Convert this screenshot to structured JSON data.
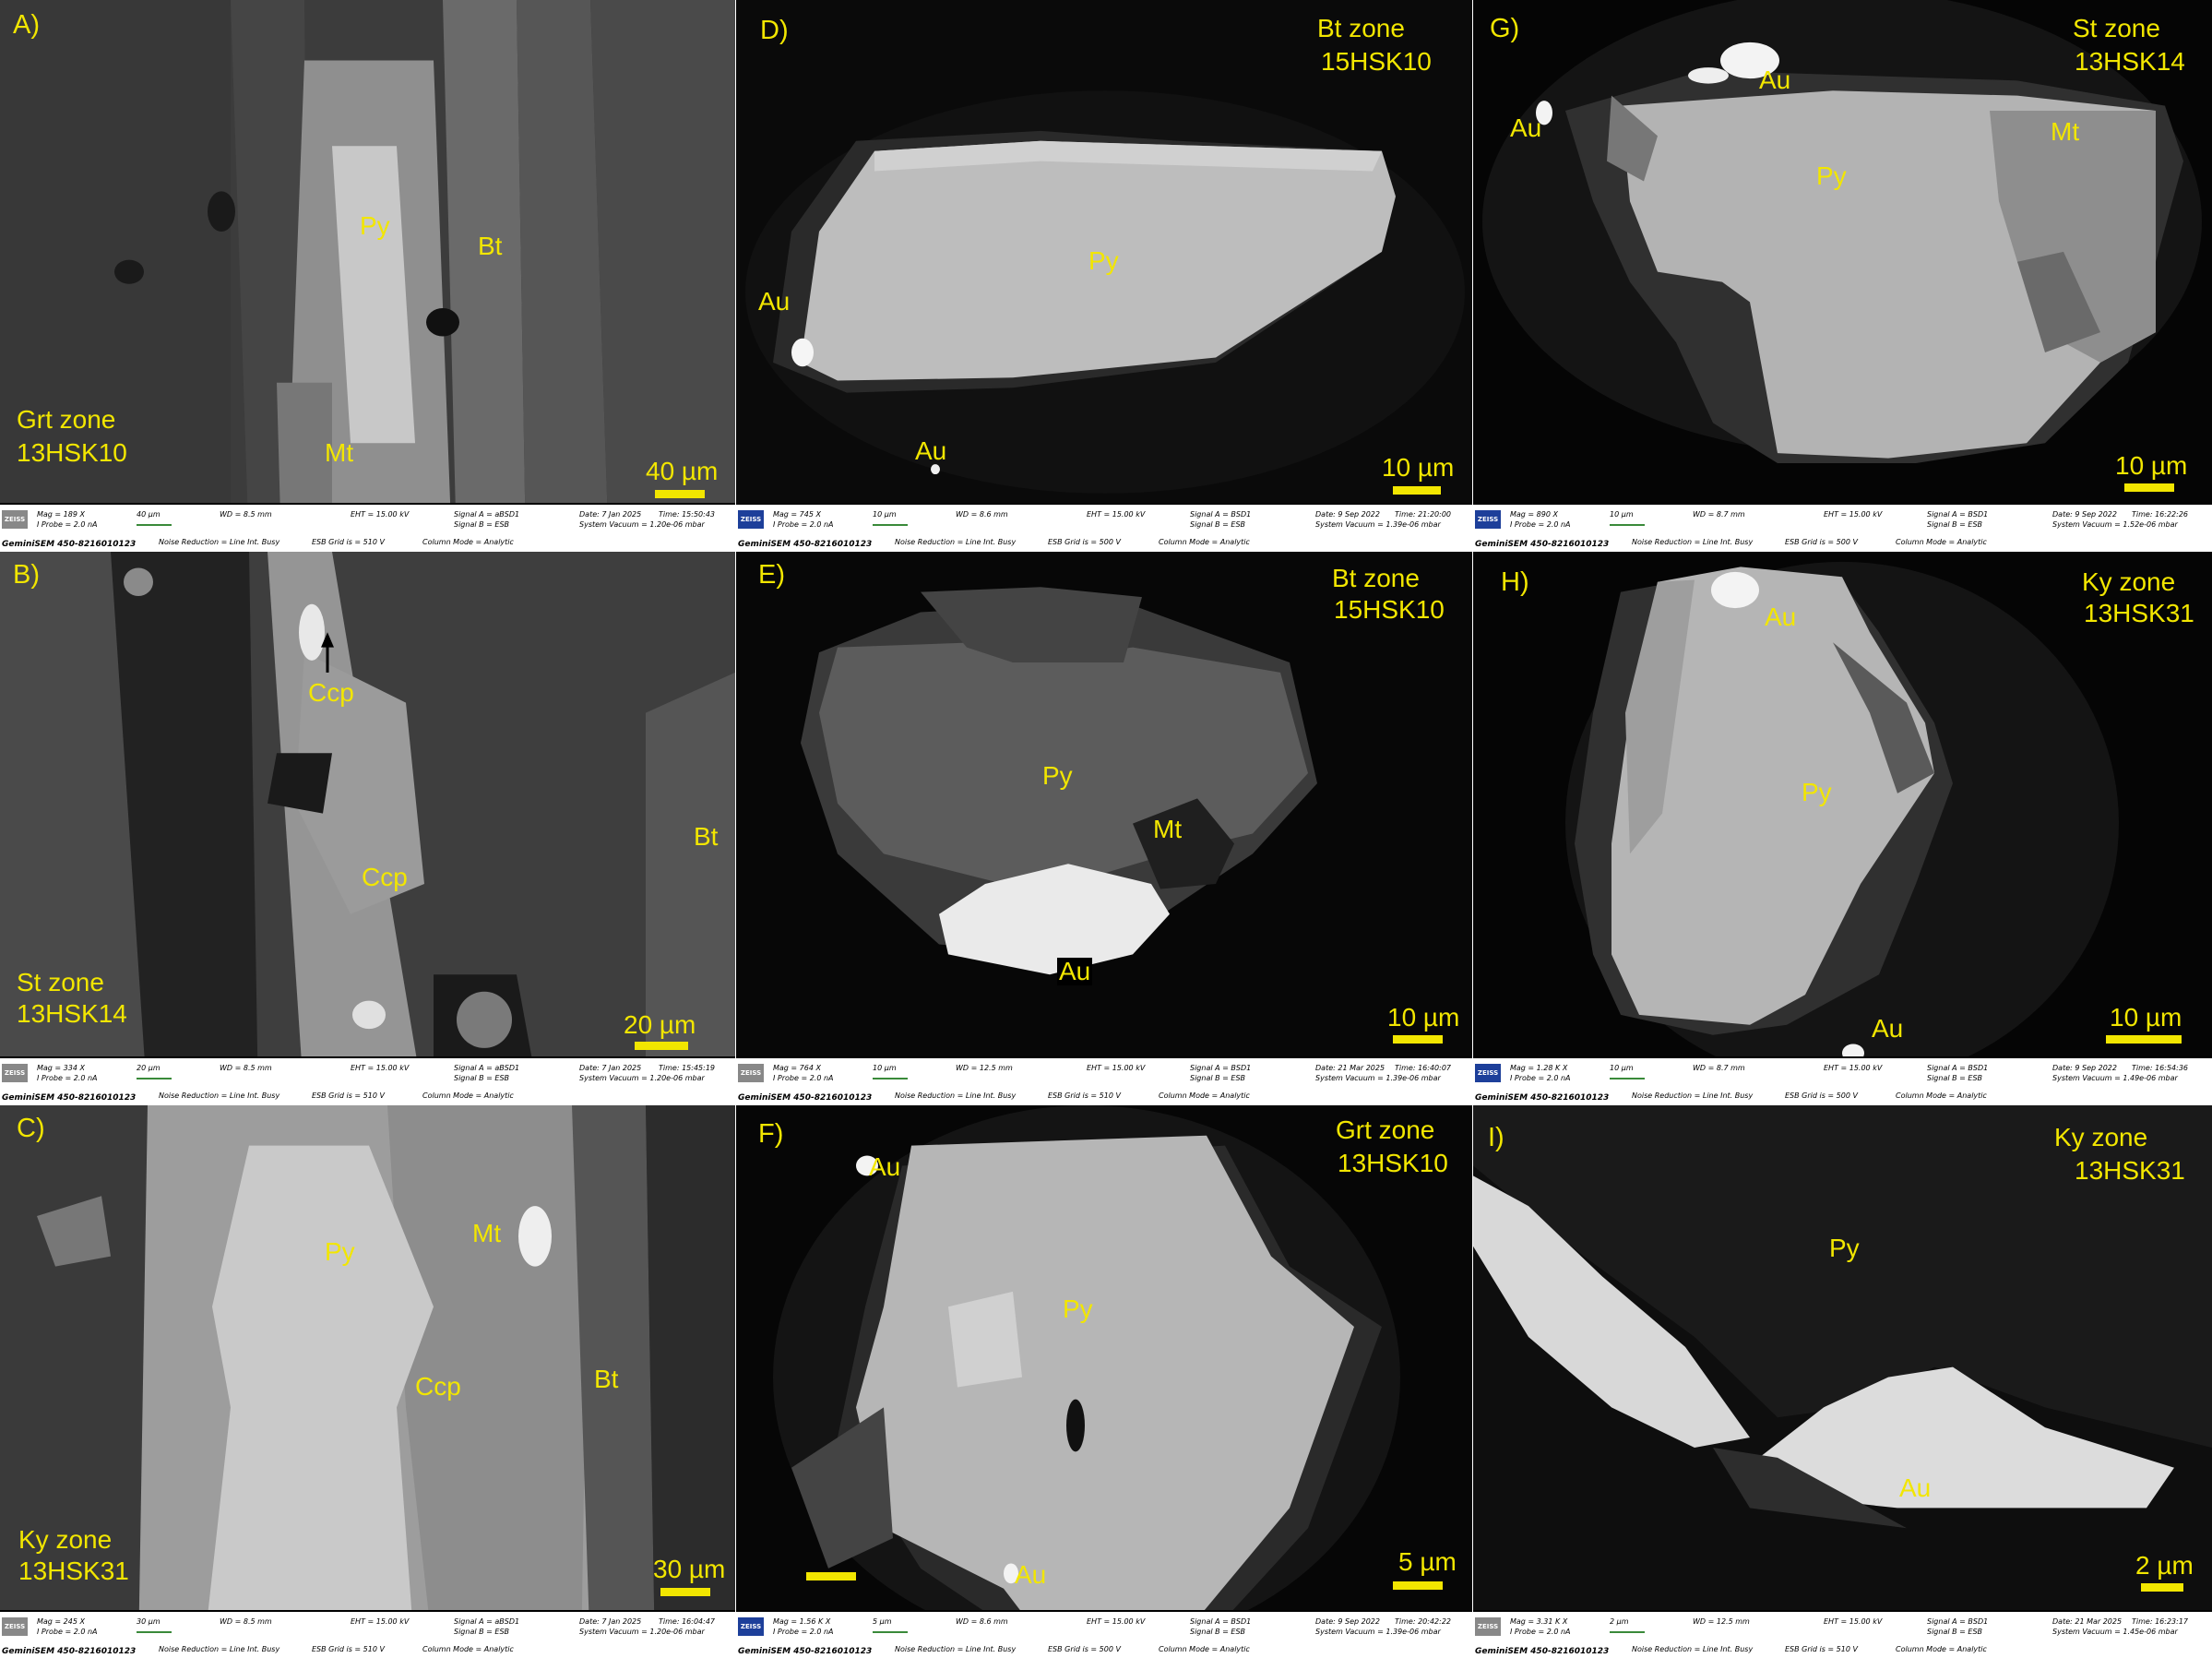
{
  "panels": [
    {
      "id": "A",
      "letter": "A)",
      "zone": "Grt zone",
      "sample": "13HSK10",
      "scale": "40 µm",
      "minerals": [
        "Py",
        "Bt",
        "Mt"
      ],
      "meta": {
        "mag": "Mag =  189 X",
        "scaleMini": "40 µm",
        "wd": "WD =  8.5 mm",
        "eht": "EHT = 15.00 kV",
        "sigA": "Signal A = aBSD1",
        "sigB": "Signal B = ESB",
        "date": "Date: 7 Jan 2025",
        "time": "Time: 15:50:43",
        "iprobe": "I Probe =   2.0 nA",
        "noise": "Noise Reduction = Line Int. Busy",
        "esb": "ESB Grid is =   510 V",
        "col": "Column Mode = Analytic",
        "vac": "System Vacuum = 1.20e-06 mbar",
        "inst": "GeminiSEM 450-8216010123"
      }
    },
    {
      "id": "D",
      "letter": "D)",
      "zone": "Bt zone",
      "sample": "15HSK10",
      "scale": "10 µm",
      "minerals": [
        "Py",
        "Au",
        "Au"
      ],
      "meta": {
        "mag": "Mag =   745 X",
        "scaleMini": "10 µm",
        "wd": "WD =  8.6 mm",
        "eht": "EHT = 15.00 kV",
        "sigA": "Signal A = BSD1",
        "sigB": "Signal B = ESB",
        "date": "Date: 9 Sep 2022",
        "time": "Time: 21:20:00",
        "iprobe": "I Probe =   2.0 nA",
        "noise": "Noise Reduction = Line Int. Busy",
        "esb": "ESB Grid is =   500 V",
        "col": "Column Mode = Analytic",
        "vac": "System Vacuum = 1.39e-06 mbar",
        "inst": "GeminiSEM 450-8216010123"
      }
    },
    {
      "id": "G",
      "letter": "G)",
      "zone": "St zone",
      "sample": "13HSK14",
      "scale": "10 µm",
      "minerals": [
        "Au",
        "Au",
        "Py",
        "Mt"
      ],
      "meta": {
        "mag": "Mag =   890 X",
        "scaleMini": "10 µm",
        "wd": "WD =  8.7 mm",
        "eht": "EHT = 15.00 kV",
        "sigA": "Signal A = BSD1",
        "sigB": "Signal B = ESB",
        "date": "Date: 9 Sep 2022",
        "time": "Time: 16:22:26",
        "iprobe": "I Probe =   2.0 nA",
        "noise": "Noise Reduction = Line Int. Busy",
        "esb": "ESB Grid is =   500 V",
        "col": "Column Mode = Analytic",
        "vac": "System Vacuum = 1.52e-06 mbar",
        "inst": "GeminiSEM 450-8216010123"
      }
    },
    {
      "id": "B",
      "letter": "B)",
      "zone": "St zone",
      "sample": "13HSK14",
      "scale": "20 µm",
      "minerals": [
        "Ccp",
        "Ccp",
        "Bt"
      ],
      "meta": {
        "mag": "Mag =  334 X",
        "scaleMini": "20 µm",
        "wd": "WD =  8.5 mm",
        "eht": "EHT = 15.00 kV",
        "sigA": "Signal A = aBSD1",
        "sigB": "Signal B = ESB",
        "date": "Date: 7 Jan 2025",
        "time": "Time: 15:45:19",
        "iprobe": "I Probe =   2.0 nA",
        "noise": "Noise Reduction = Line Int. Busy",
        "esb": "ESB Grid is =   510 V",
        "col": "Column Mode = Analytic",
        "vac": "System Vacuum = 1.20e-06 mbar",
        "inst": "GeminiSEM 450-8216010123"
      }
    },
    {
      "id": "E",
      "letter": "E)",
      "zone": "Bt zone",
      "sample": "15HSK10",
      "scale": "10 µm",
      "minerals": [
        "Py",
        "Mt",
        "Au"
      ],
      "meta": {
        "mag": "Mag =   764 X",
        "scaleMini": "10 µm",
        "wd": "WD = 12.5 mm",
        "eht": "EHT = 15.00 kV",
        "sigA": "Signal A = BSD1",
        "sigB": "Signal B = ESB",
        "date": "Date: 21 Mar 2025",
        "time": "Time: 16:40:07",
        "iprobe": "I Probe =   2.0 nA",
        "noise": "Noise Reduction = Line Int. Busy",
        "esb": "ESB Grid is =   510 V",
        "col": "Column Mode = Analytic",
        "vac": "System Vacuum = 1.39e-06 mbar",
        "inst": "GeminiSEM 450-8216010123"
      }
    },
    {
      "id": "H",
      "letter": "H)",
      "zone": "Ky zone",
      "sample": "13HSK31",
      "scale": "10 µm",
      "minerals": [
        "Au",
        "Py",
        "Au"
      ],
      "meta": {
        "mag": "Mag =  1.28 K X",
        "scaleMini": "10 µm",
        "wd": "WD =  8.7 mm",
        "eht": "EHT = 15.00 kV",
        "sigA": "Signal A = BSD1",
        "sigB": "Signal B = ESB",
        "date": "Date: 9 Sep 2022",
        "time": "Time: 16:54:36",
        "iprobe": "I Probe =   2.0 nA",
        "noise": "Noise Reduction = Line Int. Busy",
        "esb": "ESB Grid is =   500 V",
        "col": "Column Mode = Analytic",
        "vac": "System Vacuum = 1.49e-06 mbar",
        "inst": "GeminiSEM 450-8216010123"
      }
    },
    {
      "id": "C",
      "letter": "C)",
      "zone": "Ky zone",
      "sample": "13HSK31",
      "scale": "30 µm",
      "minerals": [
        "Py",
        "Mt",
        "Ccp",
        "Bt"
      ],
      "meta": {
        "mag": "Mag =  245 X",
        "scaleMini": "30 µm",
        "wd": "WD =  8.5 mm",
        "eht": "EHT = 15.00 kV",
        "sigA": "Signal A = aBSD1",
        "sigB": "Signal B = ESB",
        "date": "Date: 7 Jan 2025",
        "time": "Time: 16:04:47",
        "iprobe": "I Probe =   2.0 nA",
        "noise": "Noise Reduction = Line Int. Busy",
        "esb": "ESB Grid is =   510 V",
        "col": "Column Mode = Analytic",
        "vac": "System Vacuum = 1.20e-06 mbar",
        "inst": "GeminiSEM 450-8216010123"
      }
    },
    {
      "id": "F",
      "letter": "F)",
      "zone": "Grt zone",
      "sample": "13HSK10",
      "scale": "5 µm",
      "minerals": [
        "Au",
        "Py",
        "Au"
      ],
      "meta": {
        "mag": "Mag =  1.56 K X",
        "scaleMini": "5 µm",
        "wd": "WD =  8.6 mm",
        "eht": "EHT = 15.00 kV",
        "sigA": "Signal A = BSD1",
        "sigB": "Signal B = ESB",
        "date": "Date: 9 Sep 2022",
        "time": "Time: 20:42:22",
        "iprobe": "I Probe =   2.0 nA",
        "noise": "Noise Reduction = Line Int. Busy",
        "esb": "ESB Grid is =   500 V",
        "col": "Column Mode = Analytic",
        "vac": "System Vacuum = 1.39e-06 mbar",
        "inst": "GeminiSEM 450-8216010123"
      }
    },
    {
      "id": "I",
      "letter": "I)",
      "zone": "Ky zone",
      "sample": "13HSK31",
      "scale": "2 µm",
      "minerals": [
        "Py",
        "Au"
      ],
      "meta": {
        "mag": "Mag =  3.31 K X",
        "scaleMini": "2 µm",
        "wd": "WD = 12.5 mm",
        "eht": "EHT = 15.00 kV",
        "sigA": "Signal A = BSD1",
        "sigB": "Signal B = ESB",
        "date": "Date: 21 Mar 2025",
        "time": "Time: 16:23:17",
        "iprobe": "I Probe =   2.0 nA",
        "noise": "Noise Reduction = Line Int. Busy",
        "esb": "ESB Grid is =   510 V",
        "col": "Column Mode = Analytic",
        "vac": "System Vacuum = 1.45e-06 mbar",
        "inst": "GeminiSEM 450-8216010123"
      }
    }
  ]
}
